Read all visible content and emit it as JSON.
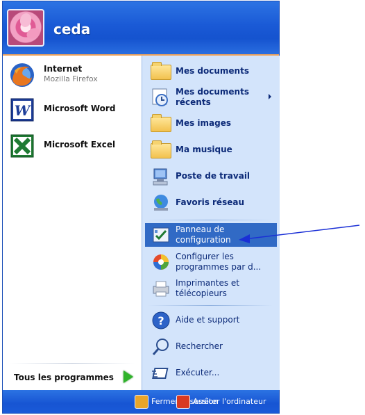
{
  "user": {
    "name": "ceda"
  },
  "left": {
    "pinned": [
      {
        "title": "Internet",
        "subtitle": "Mozilla Firefox",
        "icon": "firefox-icon"
      },
      {
        "title": "Microsoft Word",
        "icon": "word-icon"
      },
      {
        "title": "Microsoft Excel",
        "icon": "excel-icon"
      }
    ],
    "all_programs": "Tous les programmes"
  },
  "right": {
    "items": [
      {
        "label": "Mes documents",
        "icon": "folder-documents-icon"
      },
      {
        "label_line1": "Mes documents",
        "label_line2": "récents",
        "icon": "recent-documents-icon"
      },
      {
        "label": "Mes images",
        "icon": "folder-images-icon"
      },
      {
        "label": "Ma musique",
        "icon": "folder-music-icon"
      },
      {
        "label": "Poste de travail",
        "icon": "my-computer-icon"
      },
      {
        "label": "Favoris réseau",
        "icon": "network-icon"
      },
      {
        "label_line1": "Panneau de",
        "label_line2": "configuration",
        "icon": "control-panel-icon"
      },
      {
        "label_line1": "Configurer les",
        "label_line2": "programmes par d...",
        "icon": "set-program-access-icon"
      },
      {
        "label_line1": "Imprimantes et",
        "label_line2": "télécopieurs",
        "icon": "printers-icon"
      },
      {
        "label": "Aide et support",
        "icon": "help-icon"
      },
      {
        "label": "Rechercher",
        "icon": "search-icon"
      },
      {
        "label": "Exécuter...",
        "icon": "run-icon"
      }
    ]
  },
  "bottom": {
    "logoff": "Fermer la session",
    "shutdown": "Arrêter l'ordinateur"
  },
  "colors": {
    "header_blue": "#1a5ad6",
    "right_panel": "#d3e4fb",
    "selection": "#316ac5",
    "annotation_arrow": "#1a2fd6"
  }
}
